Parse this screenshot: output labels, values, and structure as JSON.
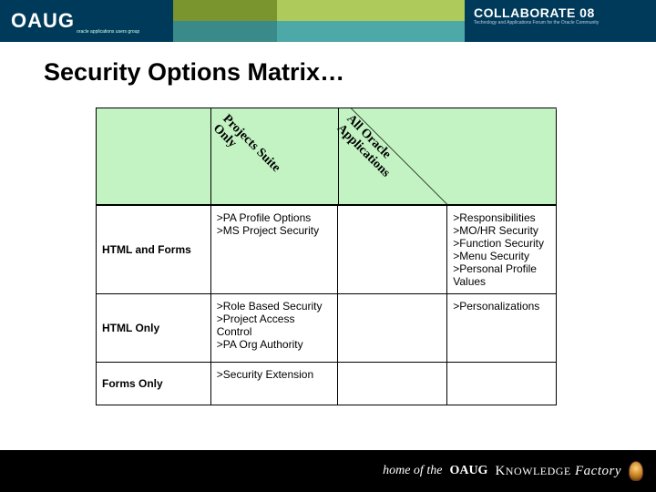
{
  "banner": {
    "logo": "OAUG",
    "logo_subtitle": "oracle applications users group",
    "collab": "COLLABORATE 08",
    "collab_subtitle": "Technology and Applications Forum for the Oracle Community"
  },
  "title": "Security Options Matrix…",
  "matrix": {
    "col_headers": [
      "Projects Suite Only",
      "All Oracle Applications"
    ],
    "rows": [
      {
        "label": "HTML and Forms",
        "cells": [
          [
            "PA Profile Options",
            "MS Project Security"
          ],
          [],
          [
            "Responsibilities",
            "MO/HR Security",
            "Function Security",
            "Menu Security",
            "Personal Profile Values"
          ]
        ]
      },
      {
        "label": "HTML Only",
        "cells": [
          [
            "Role Based Security",
            "Project Access Control",
            "PA Org Authority"
          ],
          [],
          [
            "Personalizations"
          ]
        ]
      },
      {
        "label": "Forms Only",
        "cells": [
          [
            "Security Extension"
          ],
          [],
          []
        ]
      }
    ]
  },
  "footer": {
    "prefix": "home of the",
    "oaug": "OAUG",
    "kf1": "K",
    "kf2": "NOWLEDGE",
    "kf3": " Factory"
  }
}
